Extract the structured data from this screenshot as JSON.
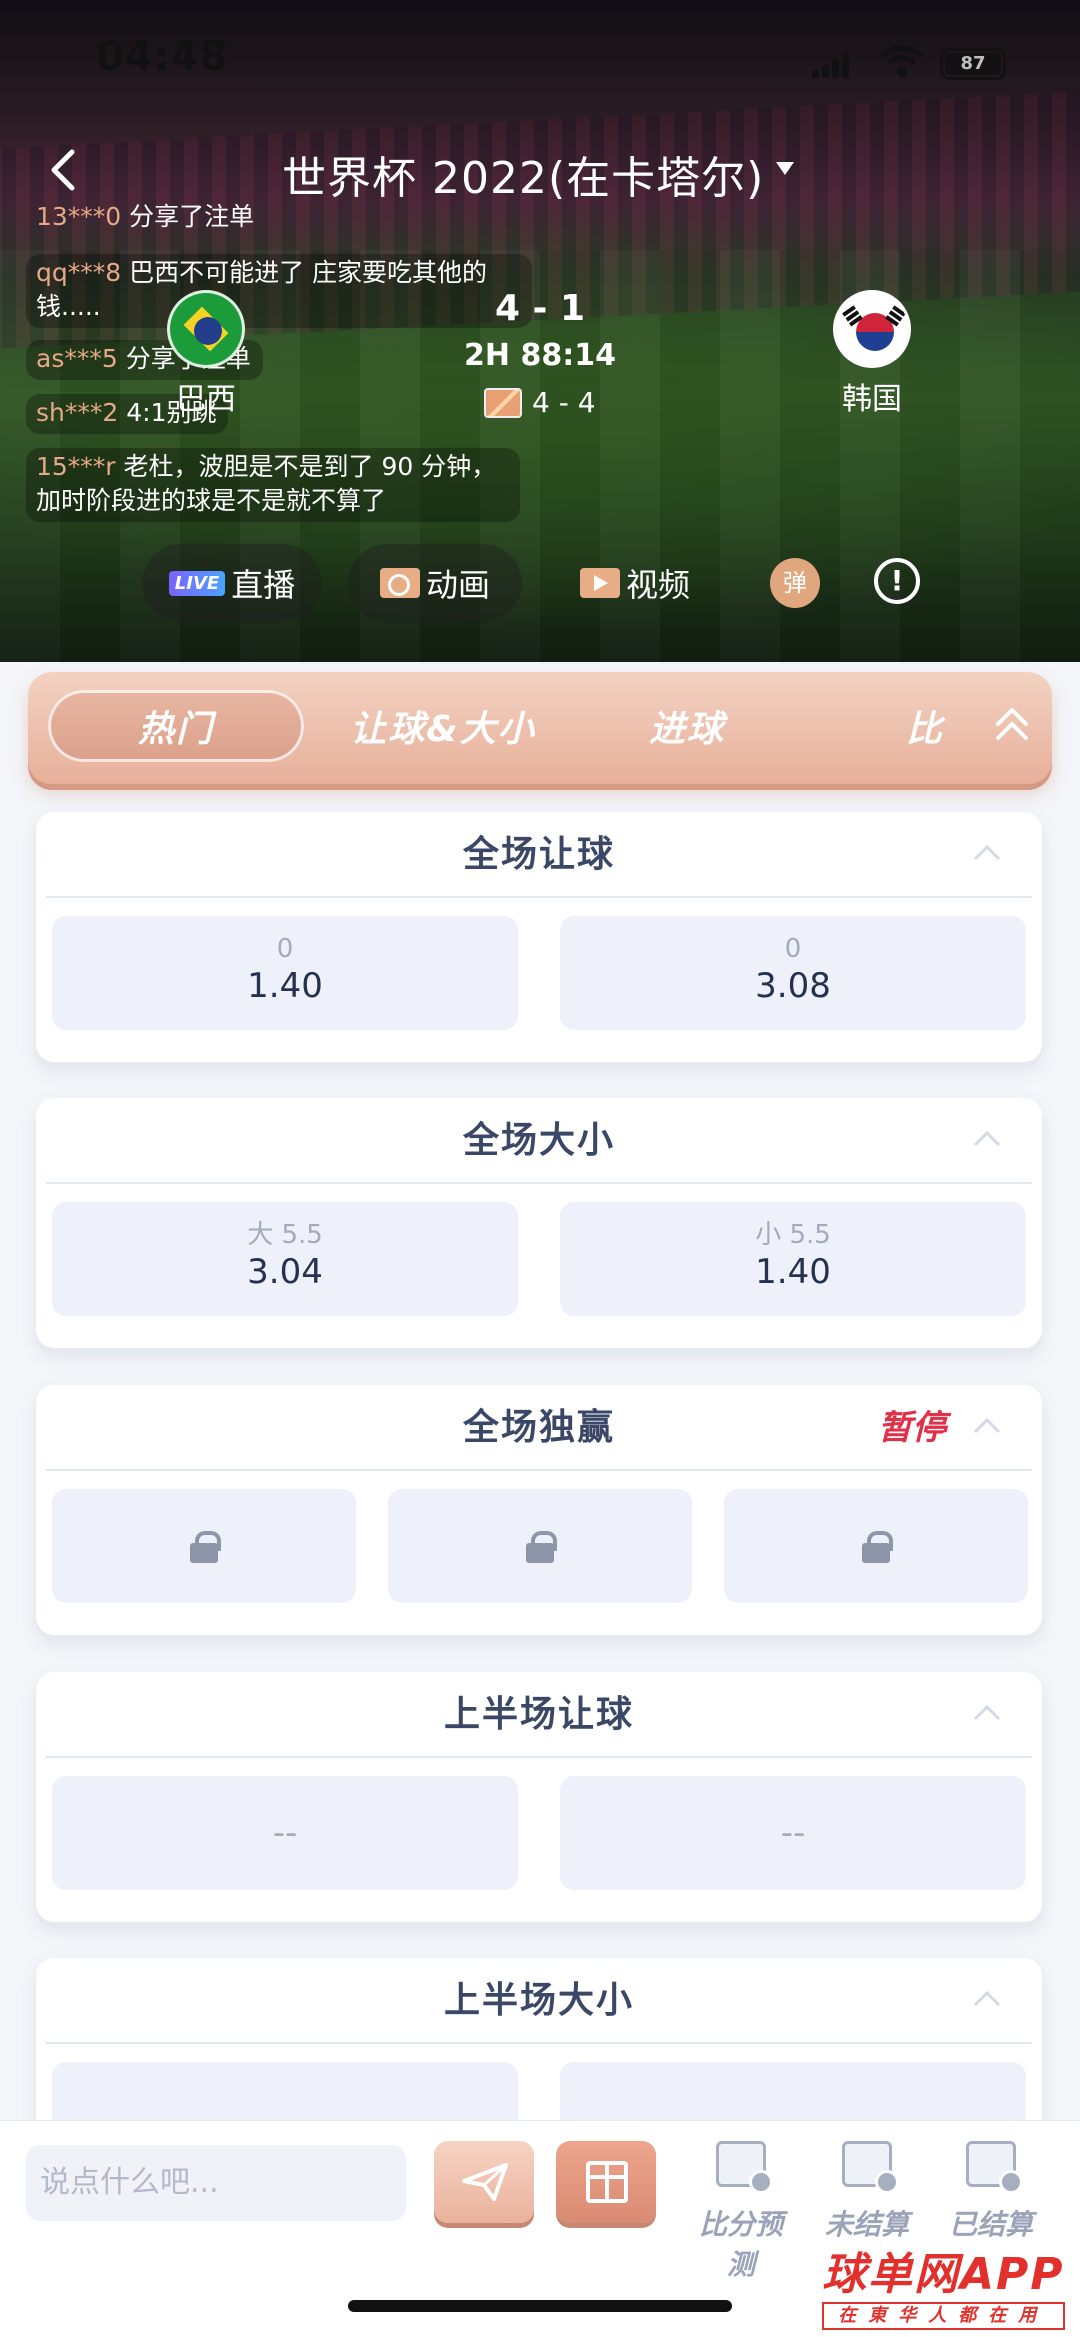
{
  "status_bar": {
    "time": "04:48",
    "battery": "87"
  },
  "header": {
    "title": "世界杯 2022(在卡塔尔)"
  },
  "chat": [
    {
      "user": "13***0",
      "text": "分享了注单"
    },
    {
      "user": "qq***8",
      "text": "巴西不可能进了 庄家要吃其他的",
      "text2": "钱....."
    },
    {
      "user": "as***5",
      "text": "分享了注单"
    },
    {
      "user": "sh***2",
      "text": "4:1别跳"
    },
    {
      "user": "15***r",
      "text": "老杜，波胆是不是到了 90 分钟，",
      "text2": "加时阶段进的球是不是就不算了"
    }
  ],
  "match": {
    "home": "巴西",
    "away": "韩国",
    "score": "4 - 1",
    "time": "2H 88:14",
    "corners": "4 - 4"
  },
  "media_buttons": {
    "live_badge": "LIVE",
    "live": "直播",
    "animation": "动画",
    "video": "视频",
    "danmaku": "弹",
    "info": "!"
  },
  "tabs": [
    "热门",
    "让球&大小",
    "进球",
    "比"
  ],
  "markets": {
    "full_handicap": {
      "title": "全场让球",
      "options": [
        {
          "label": "0",
          "odds": "1.40"
        },
        {
          "label": "0",
          "odds": "3.08"
        }
      ]
    },
    "full_total": {
      "title": "全场大小",
      "options": [
        {
          "label": "大 5.5",
          "odds": "3.04"
        },
        {
          "label": "小 5.5",
          "odds": "1.40"
        }
      ]
    },
    "full_1x2": {
      "title": "全场独赢",
      "status": "暂停"
    },
    "half_handicap": {
      "title": "上半场让球",
      "options": [
        {
          "odds": "--"
        },
        {
          "odds": "--"
        }
      ]
    },
    "half_total": {
      "title": "上半场大小"
    }
  },
  "bottom_bar": {
    "placeholder": "说点什么吧...",
    "tools": [
      "比分预测",
      "未结算",
      "已结算"
    ]
  },
  "watermark": {
    "brand": "球单网APP",
    "slogan": "在東华人都在用"
  }
}
